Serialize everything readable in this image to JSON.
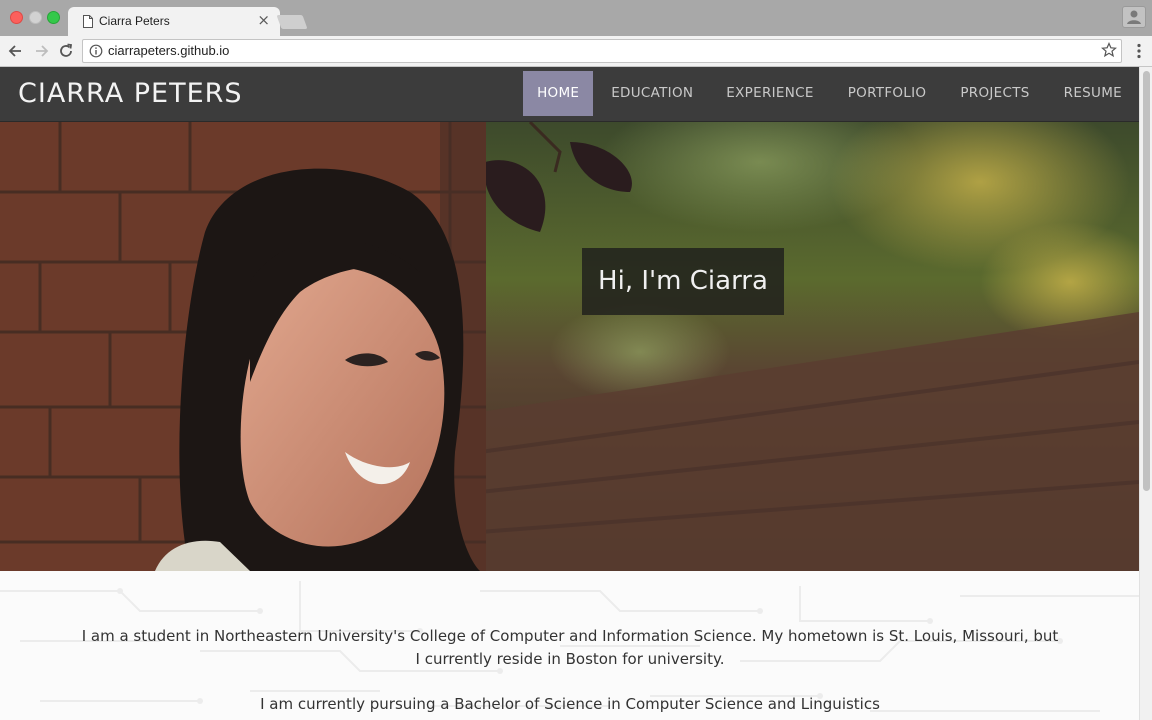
{
  "browser": {
    "tab_title": "Ciarra Peters",
    "url": "ciarrapeters.github.io"
  },
  "site": {
    "brand": "CIARRA PETERS",
    "nav": [
      {
        "label": "HOME",
        "active": true
      },
      {
        "label": "EDUCATION",
        "active": false
      },
      {
        "label": "EXPERIENCE",
        "active": false
      },
      {
        "label": "PORTFOLIO",
        "active": false
      },
      {
        "label": "PROJECTS",
        "active": false
      },
      {
        "label": "RESUME",
        "active": false
      }
    ],
    "hero_caption": "Hi, I'm Ciarra",
    "about": {
      "paragraph1": "I am a student in Northeastern University's College of Computer and Information Science. My hometown is St. Louis, Missouri, but I currently reside in Boston for university.",
      "paragraph2": "I am currently pursuing a Bachelor of Science in Computer Science and Linguistics"
    }
  },
  "colors": {
    "nav_bg": "#3c3c3c",
    "nav_active": "#8b88a4",
    "nav_text": "#c9c9c9",
    "page_bg": "#fbfbfb"
  },
  "icons": {
    "tab": "file-icon",
    "tab_close": "close-icon",
    "back": "back-arrow-icon",
    "forward": "forward-arrow-icon",
    "reload": "reload-icon",
    "site_info": "info-icon",
    "bookmark": "star-icon",
    "menu": "kebab-menu-icon",
    "profile": "profile-icon"
  }
}
